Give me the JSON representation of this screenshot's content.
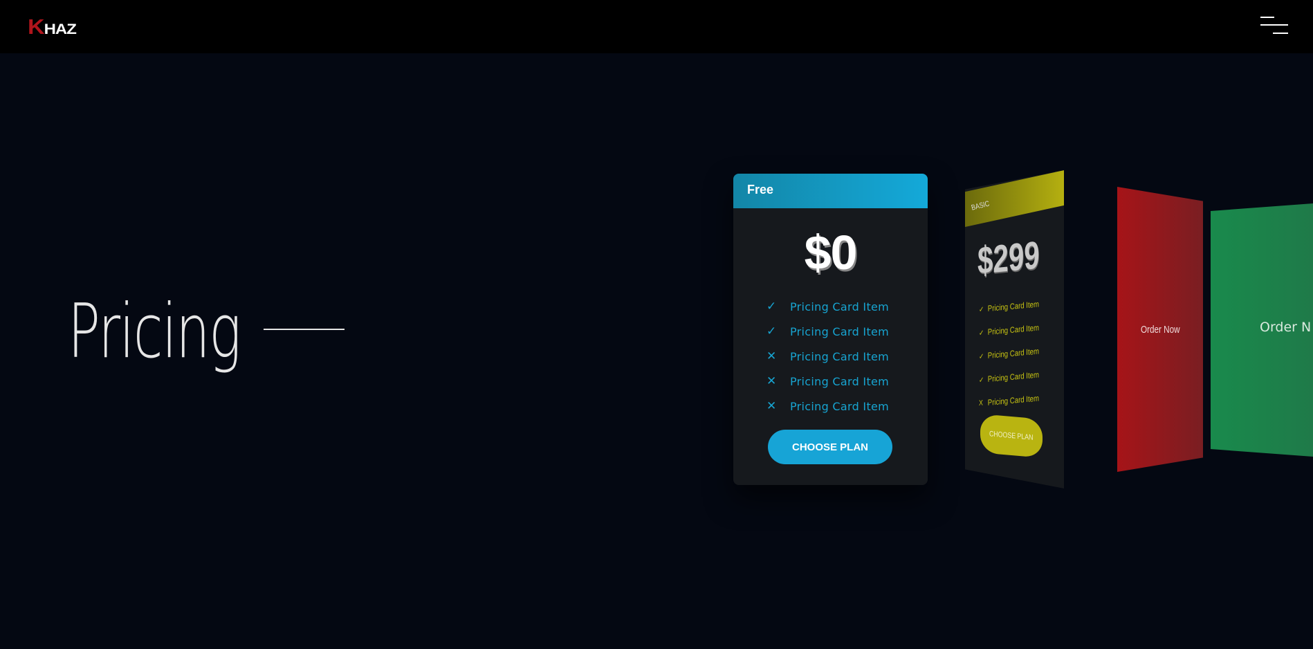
{
  "header": {
    "logo_first": "K",
    "logo_rest": "HAZ",
    "menu_icon": "hamburger-menu-icon"
  },
  "hero": {
    "title": "Pricing"
  },
  "cards": {
    "free": {
      "label": "Free",
      "price": "$0",
      "items": [
        {
          "icon": "check",
          "text": "Pricing Card Item"
        },
        {
          "icon": "cross",
          "text": "Pricing Card Item"
        },
        {
          "icon": "cross",
          "text": "Pricing Card Item"
        },
        {
          "icon": "cross",
          "text": "Pricing Card Item"
        }
      ],
      "items_all": [
        "Pricing Card Item",
        "Pricing Card Item",
        "Pricing Card Item",
        "Pricing Card Item",
        "Pricing Card Item"
      ],
      "icons": [
        "✓",
        "✓",
        "✕",
        "✕",
        "✕"
      ],
      "button": "CHOOSE PLAN",
      "accent": "#17a4d6"
    },
    "basic": {
      "label": "BASIC",
      "price": "$299",
      "items_all": [
        "Pricing Card Item",
        "Pricing Card Item",
        "Pricing Card Item",
        "Pricing Card Item",
        "Pricing Card Item"
      ],
      "icons": [
        "✓",
        "✓",
        "✓",
        "✓",
        "X"
      ],
      "button": "CHOOSE PLAN",
      "accent": "#b9b411"
    },
    "red": {
      "button": "Order Now",
      "accent": "#a61418"
    },
    "green": {
      "button": "Order N",
      "accent": "#198a4c"
    }
  }
}
